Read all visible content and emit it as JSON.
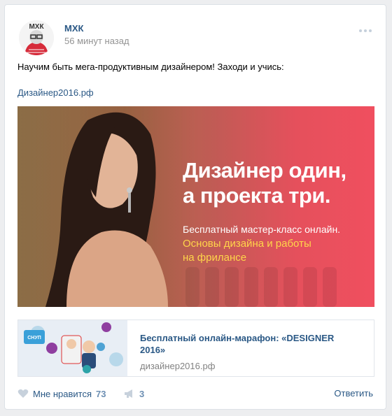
{
  "post": {
    "author": "МХК",
    "avatar_text": "МХК",
    "time": "56 минут назад",
    "text": "Научим быть мега-продуктивным дизайнером! Заходи и учись:",
    "link": "Дизайнер2016.рф"
  },
  "banner": {
    "headline_1": "Дизайнер один,",
    "headline_2": "а проекта три.",
    "subtitle": "Бесплатный мастер-класс онлайн.",
    "highlight_1": "Основы дизайна и работы",
    "highlight_2": "на фрилансе",
    "colors": {
      "accent": "#f04f5f",
      "highlight": "#ffd54a"
    }
  },
  "snippet": {
    "title": "Бесплатный онлайн-марафон: «DESIGNER 2016»",
    "domain": "дизайнер2016.рф",
    "thumb_badge": "СНУП"
  },
  "actions": {
    "like_label": "Мне нравится",
    "like_count": "73",
    "share_count": "3",
    "reply_label": "Ответить"
  },
  "icons": [
    "menu-dots-icon",
    "heart-icon",
    "megaphone-icon"
  ]
}
